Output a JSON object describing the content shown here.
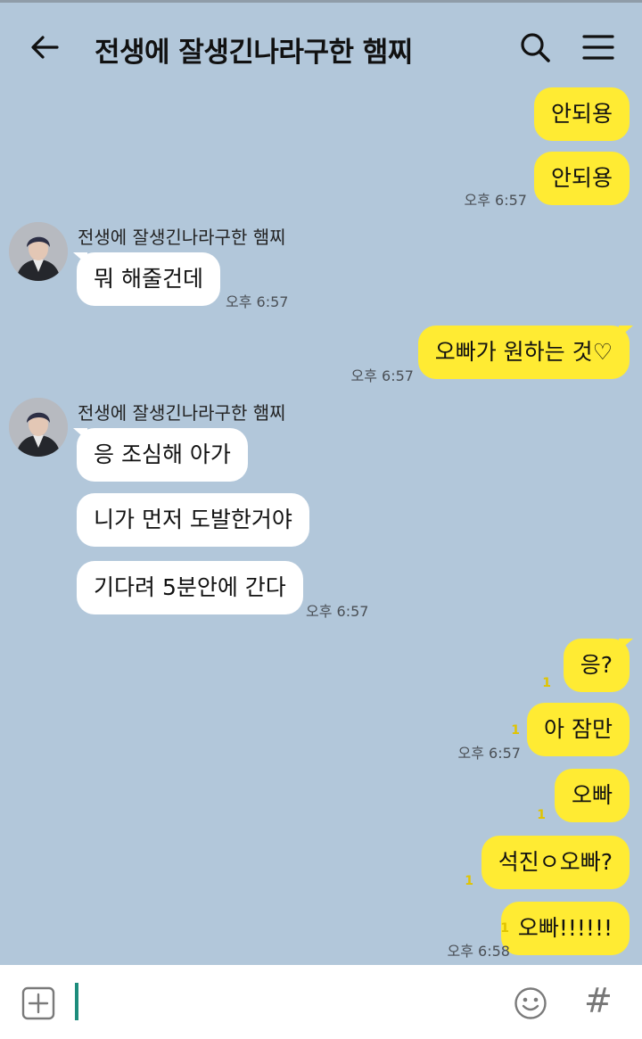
{
  "header": {
    "title": "전생에 잘생긴나라구한 햄찌",
    "back_icon": "arrow-left-icon",
    "search_icon": "search-icon",
    "menu_icon": "hamburger-menu-icon"
  },
  "colors": {
    "background": "#b2c7da",
    "my_bubble": "#ffeb33",
    "their_bubble": "#ffffff",
    "unread": "#e0c400",
    "caret": "#1d8c7c"
  },
  "messages": {
    "m1": {
      "text": "안되용"
    },
    "m2": {
      "text": "안되용",
      "time": "오후 6:57"
    },
    "sender1": "전생에 잘생긴나라구한 햄찌",
    "m3": {
      "text": "뭐 해줄건데",
      "time": "오후 6:57"
    },
    "m4": {
      "text": "오빠가 원하는 것♡",
      "time": "오후 6:57"
    },
    "sender2": "전생에 잘생긴나라구한 햄찌",
    "m5": {
      "text": "응 조심해 아가"
    },
    "m6": {
      "text": "니가 먼저 도발한거야"
    },
    "m7": {
      "text": "기다려 5분안에 간다",
      "time": "오후 6:57"
    },
    "m8": {
      "text": "응?",
      "unread": "1"
    },
    "m9": {
      "text": "아 잠만",
      "unread": "1",
      "time": "오후 6:57"
    },
    "m10": {
      "text": "오빠",
      "unread": "1"
    },
    "m11": {
      "text": "석진ㅇ오빠?",
      "unread": "1"
    },
    "m12": {
      "text": "오빠!!!!!!",
      "unread": "1",
      "time": "오후 6:58"
    }
  },
  "input": {
    "value": "",
    "plus_icon": "plus-box-icon",
    "emoji_icon": "smiley-icon",
    "hash_label": "#"
  }
}
